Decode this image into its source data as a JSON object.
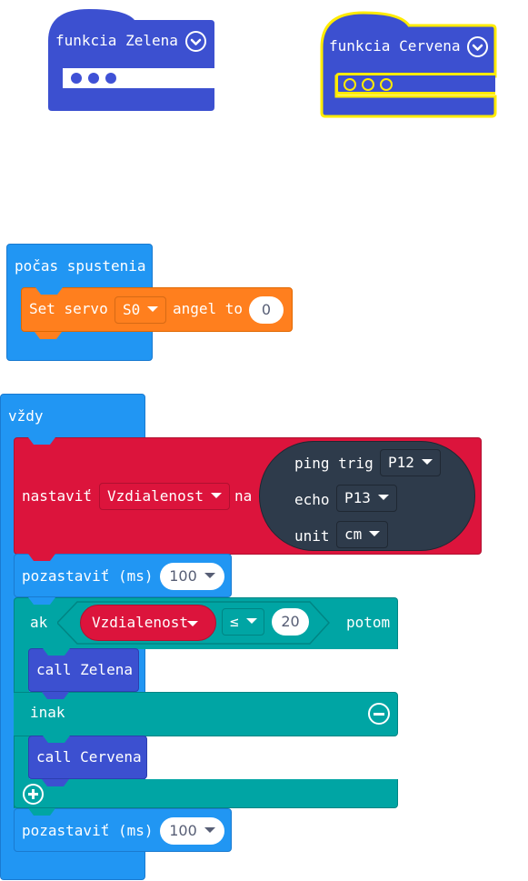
{
  "function_blocks": [
    {
      "label": "funkcia Zelena",
      "color": "#3c50d0",
      "highlighted": false
    },
    {
      "label": "funkcia Cervena",
      "color": "#3c50d0",
      "highlighted": true,
      "highlight_color": "#ffeb00"
    }
  ],
  "on_start": {
    "label": "počas spustenia",
    "color": "#2196f3",
    "servo": {
      "prefix": "Set servo",
      "pin": "S0",
      "middle": "angel to",
      "value": "0",
      "color": "#ff7f1e"
    }
  },
  "forever": {
    "label": "vždy",
    "color": "#2196f3",
    "set_variable": {
      "prefix": "nastaviť",
      "variable": "Vzdialenost",
      "middle": "na",
      "color": "#dc143c",
      "ping": {
        "trig_label": "ping trig",
        "trig_pin": "P12",
        "echo_label": "echo",
        "echo_pin": "P13",
        "unit_label": "unit",
        "unit_value": "cm",
        "color": "#2e3b4b"
      }
    },
    "pause_1": {
      "label": "pozastaviť (ms)",
      "value": "100"
    },
    "if_block": {
      "if_label": "ak",
      "variable": "Vzdialenost",
      "operator": "≤",
      "compare_value": "20",
      "then_label": "potom",
      "then_call": "call Zelena",
      "else_label": "inak",
      "else_call": "call Cervena",
      "color": "#00a5a4"
    },
    "pause_2": {
      "label": "pozastaviť (ms)",
      "value": "100"
    }
  }
}
